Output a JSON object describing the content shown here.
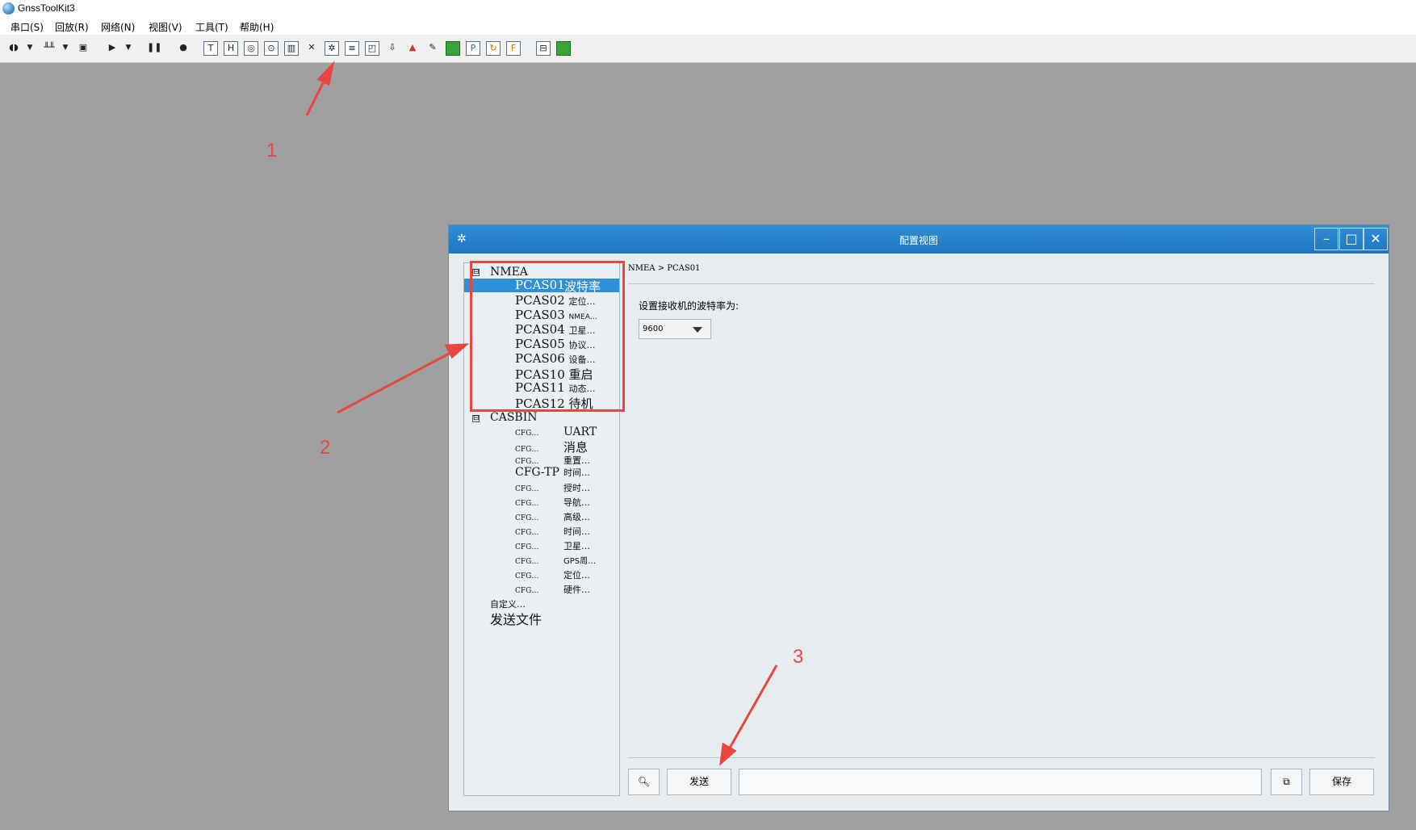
{
  "app": {
    "title": "GnssToolKit3"
  },
  "menu": [
    "串口(S)",
    "回放(R)",
    "网络(N)",
    "视图(V)",
    "工具(T)",
    "帮助(H)"
  ],
  "toolbar": {
    "icons": [
      "serial-connect-icon",
      "dropdown-icon",
      "waveform-icon",
      "dropdown-icon",
      "save-icon",
      "play-icon",
      "dropdown-icon",
      "pause-icon",
      "microphone-icon",
      "text-view-icon",
      "hex-view-icon",
      "skyview-icon",
      "position-view-icon",
      "signal-bars-icon",
      "satellite-icon",
      "config-view-icon",
      "list-view-icon",
      "chart-view-icon",
      "download-icon",
      "tilt-icon",
      "antenna-icon",
      "green-square-icon",
      "ppp-icon",
      "sync-icon",
      "file-icon",
      "window-layout-icon",
      "map-icon"
    ]
  },
  "annotations": {
    "n1": "1",
    "n2": "2",
    "n3": "3"
  },
  "config_window": {
    "title": "配置视图",
    "gear": "✲",
    "buttons": {
      "minimize": "–",
      "maximize": "□",
      "close": "✕"
    },
    "breadcrumb": "NMEA > PCAS01",
    "prompt": "设置接收机的波特率为:",
    "baud_value": "9600",
    "send_label": "发送",
    "save_label": "保存",
    "command_value": ""
  },
  "tree": {
    "nmea": {
      "label": "NMEA",
      "expander": "⊟",
      "items": [
        {
          "name": "PCAS01",
          "desc": "波特率"
        },
        {
          "name": "PCAS02",
          "desc": "定位…"
        },
        {
          "name": "PCAS03",
          "desc": "NMEA…"
        },
        {
          "name": "PCAS04",
          "desc": "卫星…"
        },
        {
          "name": "PCAS05",
          "desc": "协议…"
        },
        {
          "name": "PCAS06",
          "desc": "设备…"
        },
        {
          "name": "PCAS10",
          "desc": "重启"
        },
        {
          "name": "PCAS11",
          "desc": "动态…"
        },
        {
          "name": "PCAS12",
          "desc": "待机"
        }
      ]
    },
    "casbin": {
      "label": "CASBIN",
      "expander": "⊟",
      "items": [
        {
          "name": "CFG…",
          "desc": "UART"
        },
        {
          "name": "CFG…",
          "desc": "消息"
        },
        {
          "name": "CFG…",
          "desc": "重置…"
        },
        {
          "name": "CFG-TP",
          "desc": "时间…"
        },
        {
          "name": "CFG…",
          "desc": "授时…"
        },
        {
          "name": "CFG…",
          "desc": "导航…"
        },
        {
          "name": "CFG…",
          "desc": "高级…"
        },
        {
          "name": "CFG…",
          "desc": "时间…"
        },
        {
          "name": "CFG…",
          "desc": "卫星…"
        },
        {
          "name": "CFG…",
          "desc": "GPS周…"
        },
        {
          "name": "CFG…",
          "desc": "定位…"
        },
        {
          "name": "CFG…",
          "desc": "硬件…"
        }
      ]
    },
    "custom": "自定义…",
    "send_file": "发送文件"
  }
}
